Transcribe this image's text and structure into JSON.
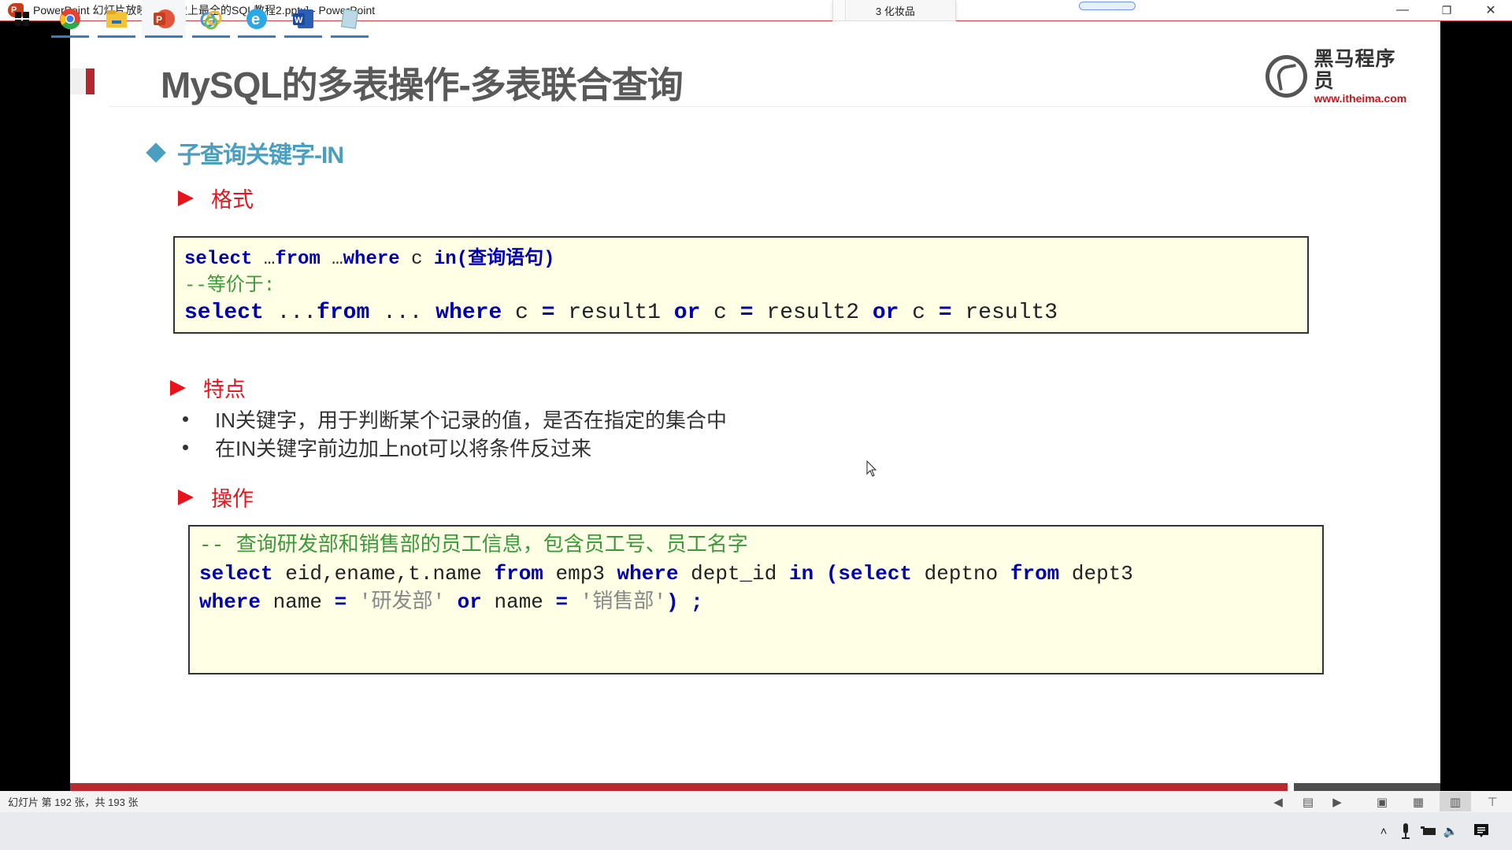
{
  "window": {
    "title": "PowerPoint 幻灯片放映 - [01-史上最全的SQL教程2.pptx] - PowerPoint",
    "app_icon": "powerpoint-icon",
    "popup_text": "3 化妆品",
    "controls": {
      "minimize": "—",
      "restore": "❐",
      "close": "✕"
    }
  },
  "slide": {
    "title": "MySQL的多表操作-多表联合查询",
    "logo": {
      "name": "黑马程序员",
      "url": "www.itheima.com"
    },
    "section_heading": "子查询关键字-IN",
    "subsections": [
      {
        "label": "格式"
      },
      {
        "label": "特点"
      },
      {
        "label": "操作"
      }
    ],
    "format_code": {
      "line1": [
        {
          "t": "select",
          "k": "kw"
        },
        {
          "t": " …",
          "k": "tx"
        },
        {
          "t": "from",
          "k": "kw"
        },
        {
          "t": " …",
          "k": "tx"
        },
        {
          "t": "where",
          "k": "kw"
        },
        {
          "t": " c ",
          "k": "tx"
        },
        {
          "t": "in(查询语句)",
          "k": "kw"
        }
      ],
      "line2": [
        {
          "t": "--等价于:",
          "k": "cm"
        }
      ],
      "line3": [
        {
          "t": "select",
          "k": "kw"
        },
        {
          "t": " ...",
          "k": "tx"
        },
        {
          "t": "from",
          "k": "kw"
        },
        {
          "t": " ... ",
          "k": "tx"
        },
        {
          "t": "where",
          "k": "kw"
        },
        {
          "t": " c ",
          "k": "tx"
        },
        {
          "t": "=",
          "k": "kw"
        },
        {
          "t": " result1 ",
          "k": "tx"
        },
        {
          "t": "or",
          "k": "kw"
        },
        {
          "t": " c ",
          "k": "tx"
        },
        {
          "t": "=",
          "k": "kw"
        },
        {
          "t": " result2 ",
          "k": "tx"
        },
        {
          "t": "or",
          "k": "kw"
        },
        {
          "t": " c ",
          "k": "tx"
        },
        {
          "t": "=",
          "k": "kw"
        },
        {
          "t": " result3",
          "k": "tx"
        }
      ]
    },
    "features": [
      "IN关键字，用于判断某个记录的值，是否在指定的集合中",
      "在IN关键字前边加上not可以将条件反过来"
    ],
    "operation_code": {
      "line1": [
        {
          "t": "-- 查询研发部和销售部的员工信息，包含员工号、员工名字",
          "k": "cm"
        }
      ],
      "line2": [
        {
          "t": "select",
          "k": "kw"
        },
        {
          "t": " eid,ename,t.name ",
          "k": "tx"
        },
        {
          "t": "from",
          "k": "kw"
        },
        {
          "t": " emp3 ",
          "k": "tx"
        },
        {
          "t": "where",
          "k": "kw"
        },
        {
          "t": " dept_id ",
          "k": "tx"
        },
        {
          "t": "in",
          "k": "kw"
        },
        {
          "t": " ",
          "k": "tx"
        },
        {
          "t": "(select",
          "k": "kw"
        },
        {
          "t": " deptno ",
          "k": "tx"
        },
        {
          "t": "from",
          "k": "kw"
        },
        {
          "t": " dept3",
          "k": "tx"
        }
      ],
      "line3": [
        {
          "t": "where",
          "k": "kw"
        },
        {
          "t": " name ",
          "k": "tx"
        },
        {
          "t": "=",
          "k": "kw"
        },
        {
          "t": " '研发部' ",
          "k": "str"
        },
        {
          "t": "or",
          "k": "kw"
        },
        {
          "t": " name ",
          "k": "tx"
        },
        {
          "t": "=",
          "k": "kw"
        },
        {
          "t": " '销售部'",
          "k": "str"
        },
        {
          "t": ")",
          "k": "kw"
        },
        {
          "t": " ;",
          "k": "kw"
        }
      ]
    }
  },
  "progress": {
    "current": 192,
    "total": 193,
    "fraction": 0.8886
  },
  "statusbar": {
    "slide_info": "幻灯片 第 192 张，共 193 张",
    "icons": [
      "previous-icon",
      "notes-icon",
      "next-icon",
      "normal-view-icon",
      "slide-sorter-icon",
      "reading-view-icon",
      "slideshow-icon"
    ]
  },
  "taskbar": {
    "items": [
      "start-icon",
      "chrome-icon",
      "file-explorer-icon",
      "powerpoint-icon",
      "app-icon",
      "browser-e-icon",
      "word-icon",
      "notepad-icon"
    ],
    "tray": [
      "chevron-up-icon",
      "microphone-icon",
      "battery-icon",
      "volume-icon",
      "notification-icon"
    ]
  },
  "colors": {
    "accent_red": "#b32d30",
    "heading_blue": "#4a9fc0",
    "subheading_red": "#e8141b",
    "code_bg": "#ffffe6",
    "keyword_blue": "#0000b8",
    "comment_green": "#3a9b3a"
  }
}
